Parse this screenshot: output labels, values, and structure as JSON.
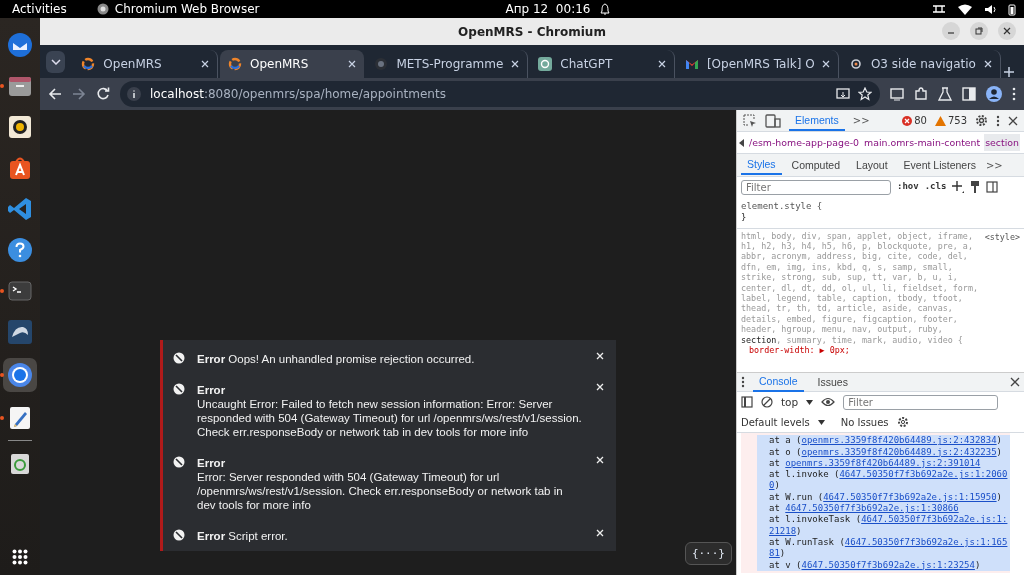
{
  "top_bar": {
    "activities": "Activities",
    "app_name": "Chromium Web Browser",
    "clock": "Апр 12  00:16"
  },
  "dock": {
    "items": [
      {
        "kind": "mail",
        "running": false,
        "selected": false
      },
      {
        "kind": "files",
        "running": true,
        "selected": false
      },
      {
        "kind": "music",
        "running": false,
        "selected": false
      },
      {
        "kind": "store",
        "running": false,
        "selected": false
      },
      {
        "kind": "code",
        "running": false,
        "selected": false
      },
      {
        "kind": "help",
        "running": false,
        "selected": false
      },
      {
        "kind": "terminal",
        "running": true,
        "selected": false
      },
      {
        "kind": "database",
        "running": false,
        "selected": false
      },
      {
        "kind": "browser",
        "running": true,
        "selected": true
      },
      {
        "kind": "editor",
        "running": true,
        "selected": false
      },
      {
        "kind": "trash",
        "running": false,
        "selected": false
      }
    ]
  },
  "window": {
    "title": "OpenMRS - Chromium"
  },
  "tabs": [
    {
      "label": "OpenMRS",
      "kind": "openmrs",
      "selected": false
    },
    {
      "label": "OpenMRS",
      "kind": "openmrs",
      "selected": true
    },
    {
      "label": "METS-Programme",
      "kind": "github",
      "selected": false
    },
    {
      "label": "ChatGPT",
      "kind": "chatgpt",
      "selected": false
    },
    {
      "label": "[OpenMRS Talk] O",
      "kind": "gmail",
      "selected": false
    },
    {
      "label": "O3 side navigatio",
      "kind": "talk",
      "selected": false
    }
  ],
  "address": {
    "host": "localhost",
    "path": ":8080/openmrs/spa/home/appointments"
  },
  "toasts": [
    {
      "kind": "inline",
      "title": "Error",
      "message": "Oops! An unhandled promise rejection occurred."
    },
    {
      "kind": "block",
      "title": "Error",
      "message": "Uncaught Error: Failed to fetch new session information: Error: Server responded with 504 (Gateway Timeout) for url /openmrs/ws/rest/v1/session. Check err.responseBody or network tab in dev tools for more info"
    },
    {
      "kind": "block",
      "title": "Error",
      "message": "Error: Server responded with 504 (Gateway Timeout) for url /openmrs/ws/rest/v1/session. Check err.responseBody or network tab in dev tools for more info"
    },
    {
      "kind": "inline",
      "title": "Error",
      "message": "Script error."
    }
  ],
  "overrides_button": {
    "label": "{···}"
  },
  "devtools": {
    "panel_tabs": [
      {
        "label": "Elements",
        "selected": true
      }
    ],
    "more_tabs": ">>",
    "error_count": "80",
    "warning_count": "753",
    "breadcrumbs": [
      {
        "label": "/esm-home-app-page-0",
        "selected": false
      },
      {
        "label": "main.omrs-main-content",
        "selected": false
      },
      {
        "label": "section",
        "selected": true
      }
    ],
    "style_tabs": [
      {
        "label": "Styles",
        "selected": true
      },
      {
        "label": "Computed",
        "selected": false
      },
      {
        "label": "Layout",
        "selected": false
      },
      {
        "label": "Event Listeners",
        "selected": false
      }
    ],
    "more_style_tabs": ">>",
    "filter": {
      "placeholder": "Filter"
    },
    "hov": ":hov",
    "cls": ".cls",
    "element_style": "element.style {",
    "element_style_close": "}",
    "rule_selector": "html, body, div, span, applet, object, iframe, h1, h2, h3, h4, h5, h6, p, blockquote, pre, a, abbr, acronym, address, big, cite, code, del, dfn, em, img, ins, kbd, q, s, samp, small, strike, strong, sub, sup, tt, var, b, u, i, center, dl, dt, dd, ol, ul, li, fieldset, form, label, legend, table, caption, tbody, tfoot, thead, tr, th, td, article, aside, canvas, details, embed, figure, figcaption, footer, header, hgroup, menu, nav, output, ruby, **section**, summary, time, mark, audio, video {",
    "rule_source": "<style>",
    "rule_property": "border-width: ▶ 0px;",
    "drawer_tabs": [
      {
        "label": "Console",
        "selected": true
      },
      {
        "label": "Issues",
        "selected": false
      }
    ],
    "context": "top",
    "console_filter": {
      "placeholder": "Filter"
    },
    "levels": "Default levels",
    "issues": "No Issues",
    "stack": [
      {
        "prefix": "at a (",
        "link": "openmrs.3359f8f420b64489.js:2:432834",
        "suffix": ")"
      },
      {
        "prefix": "at o (",
        "link": "openmrs.3359f8f420b64489.js:2:432235",
        "suffix": ")"
      },
      {
        "prefix": "at ",
        "link": "openmrs.3359f8f420b64489.js:2:391014"
      },
      {
        "prefix": "at l.invoke (",
        "link": "4647.50350f7f3b692a2e.js:1:20600",
        "suffix": ")"
      },
      {
        "prefix": "at W.run (",
        "link": "4647.50350f7f3b692a2e.js:1:15950",
        "suffix": ")"
      },
      {
        "prefix": "at ",
        "link": "4647.50350f7f3b692a2e.js:1:30866"
      },
      {
        "prefix": "at l.invokeTask (",
        "link": "4647.50350f7f3b692a2e.js:1:21218",
        "suffix": ")"
      },
      {
        "prefix": "at W.runTask (",
        "link": "4647.50350f7f3b692a2e.js:1:16581",
        "suffix": ")"
      },
      {
        "prefix": "at v (",
        "link": "4647.50350f7f3b692a2e.js:1:23254",
        "suffix": ")"
      }
    ]
  }
}
